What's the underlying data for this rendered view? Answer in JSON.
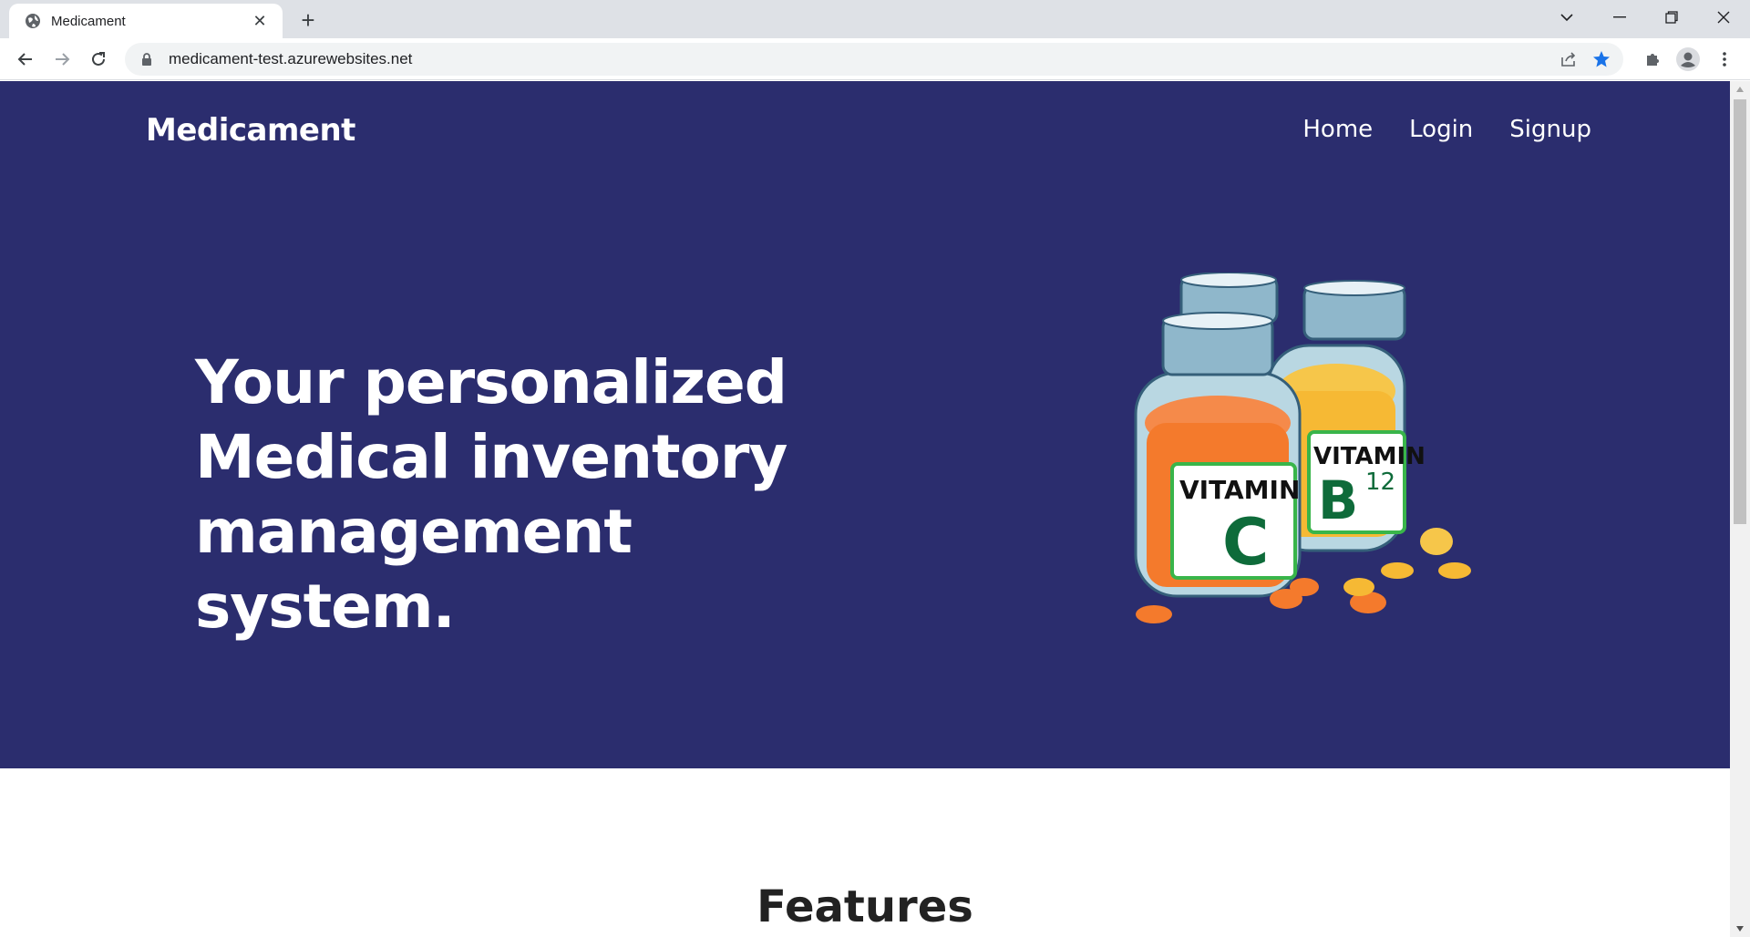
{
  "browser": {
    "tab": {
      "title": "Medicament",
      "favicon": "globe-icon"
    },
    "new_tab_symbol": "+",
    "close_symbol": "✕",
    "address_bar": {
      "url": "medicament-test.azurewebsites.net",
      "lock_icon": "lock-icon"
    },
    "toolbar_icons": [
      "back-arrow-icon",
      "forward-arrow-icon",
      "reload-icon",
      "share-icon",
      "bookmark-star-icon",
      "extensions-puzzle-icon",
      "profile-avatar-icon",
      "kebab-menu-icon"
    ],
    "window_controls": [
      "tab-search-chevron-icon",
      "minimize-icon",
      "restore-icon",
      "close-window-icon"
    ],
    "accent_color": "#1a73e8"
  },
  "site": {
    "brand": "Medicament",
    "nav": [
      {
        "label": "Home"
      },
      {
        "label": "Login"
      },
      {
        "label": "Signup"
      }
    ],
    "hero": {
      "headline_lines": [
        "Your personalized",
        "Medical inventory",
        "management system."
      ],
      "background_color": "#2b2d6e",
      "illustration": {
        "name": "vitamin-bottles-illustration",
        "front_label_top": "VITAMIN",
        "front_label_letter": "C",
        "back_label_top": "VITAMIN",
        "back_label_letter": "B",
        "back_label_sup": "12"
      }
    },
    "features_title": "Features"
  }
}
